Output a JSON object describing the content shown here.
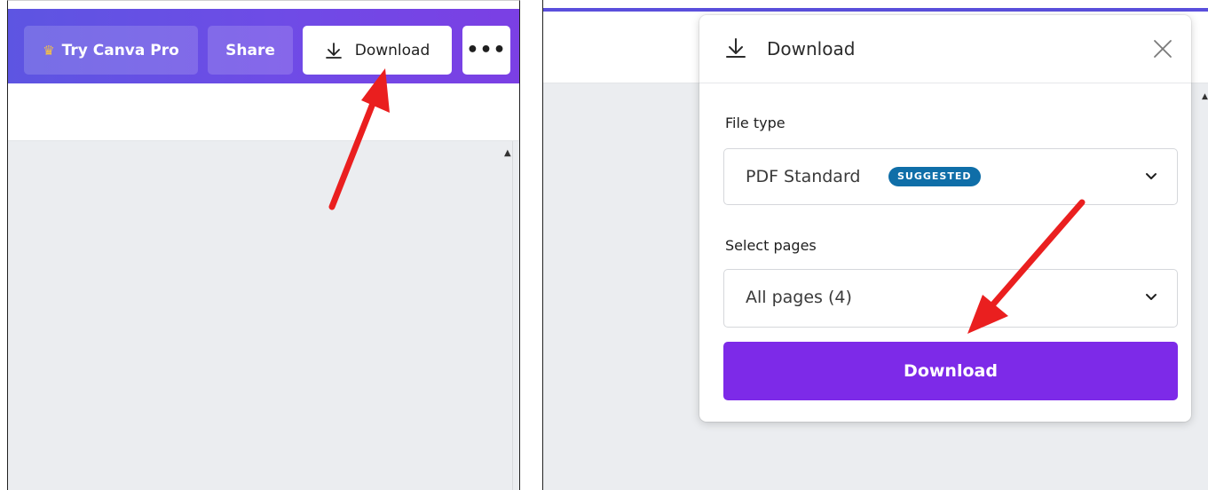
{
  "left": {
    "topbar": {
      "try_pro_label": "Try Canva Pro",
      "share_label": "Share",
      "download_label": "Download",
      "more_label": "•••"
    }
  },
  "right": {
    "dialog": {
      "title": "Download",
      "file_type_label": "File type",
      "file_type_value": "PDF Standard",
      "file_type_badge": "SUGGESTED",
      "select_pages_label": "Select pages",
      "select_pages_value": "All pages (4)",
      "download_button_label": "Download"
    }
  },
  "colors": {
    "topbar_gradient_start": "#5d55e2",
    "topbar_gradient_end": "#7b3fe4",
    "primary_button": "#7d2ae8",
    "badge": "#0f6ea8",
    "annotation_arrow": "#ea1f1f",
    "canvas_background": "#ebedf0"
  },
  "icons": {
    "crown": "crown-icon",
    "download": "download-icon",
    "close": "close-icon",
    "chevron": "chevron-down-icon"
  }
}
